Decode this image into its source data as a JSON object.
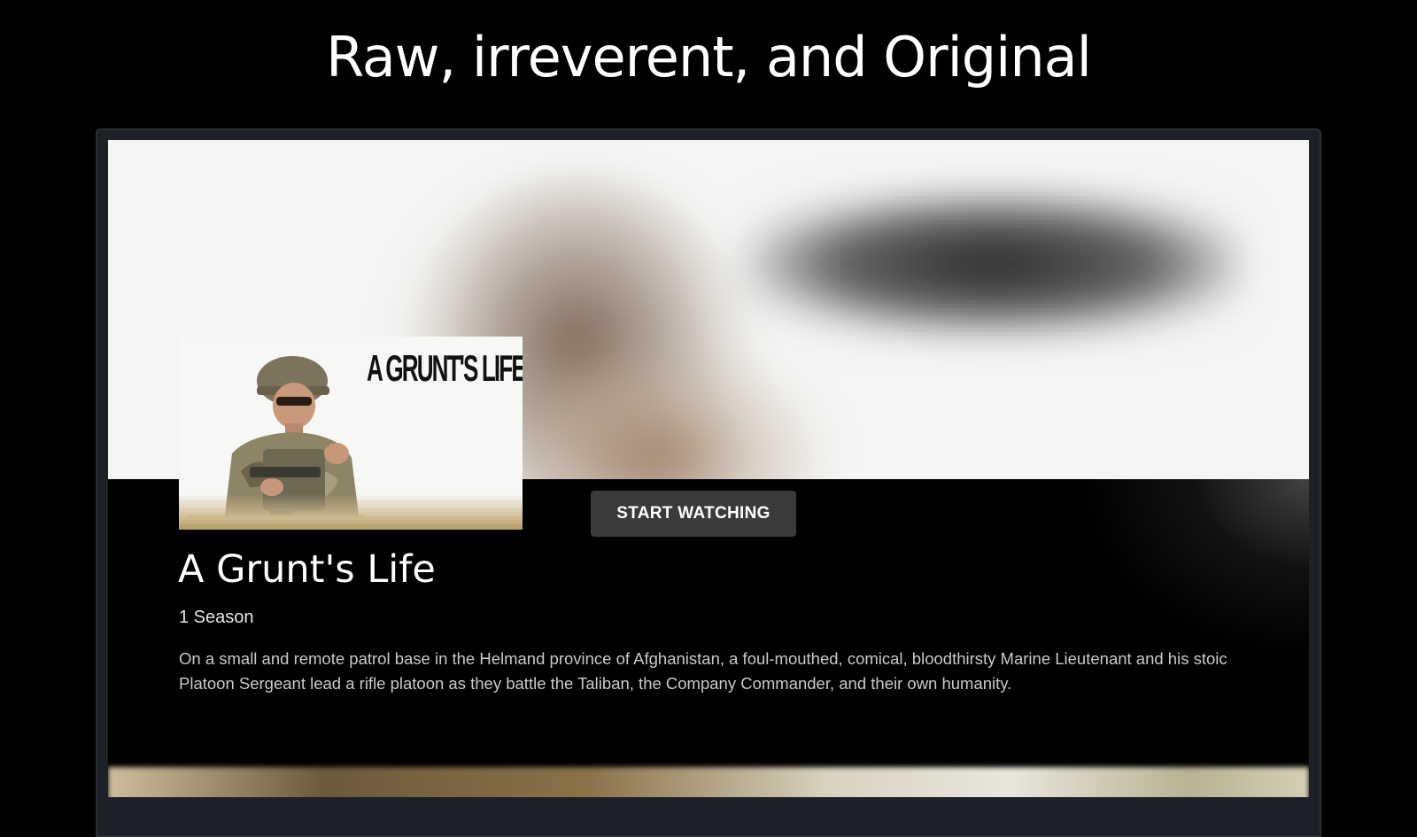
{
  "header": {
    "headline": "Raw, irreverent, and Original"
  },
  "show": {
    "poster_title": "A GRUNT'S LIFE",
    "cta_label": "START WATCHING",
    "title": "A Grunt's Life",
    "seasons": "1 Season",
    "description": "On a small and remote patrol base in the Helmand province of Afghanistan, a foul-mouthed, comical, bloodthirsty Marine Lieutenant and his stoic Platoon Sergeant lead a rifle platoon as they battle the Taliban, the Company Commander, and their own humanity."
  }
}
